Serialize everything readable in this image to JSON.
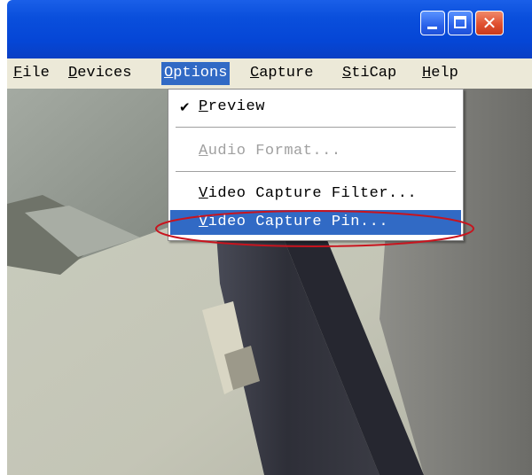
{
  "menubar": {
    "items": [
      "File",
      "Devices",
      "Options",
      "Capture",
      "StiCap",
      "Help"
    ],
    "active": "Options"
  },
  "options_menu": {
    "preview": "Preview",
    "audio_format": "Audio Format...",
    "video_capture_filter": "Video Capture Filter...",
    "video_capture_pin": "Video Capture Pin..."
  },
  "close_glyph": "✕",
  "check_glyph": "✔",
  "colors": {
    "titlebar": "#0a4fdc",
    "menu_highlight": "#316ac5",
    "annotation": "#c8141e"
  },
  "icons": [
    "minimize-icon",
    "maximize-icon",
    "close-icon",
    "checkmark-icon"
  ]
}
